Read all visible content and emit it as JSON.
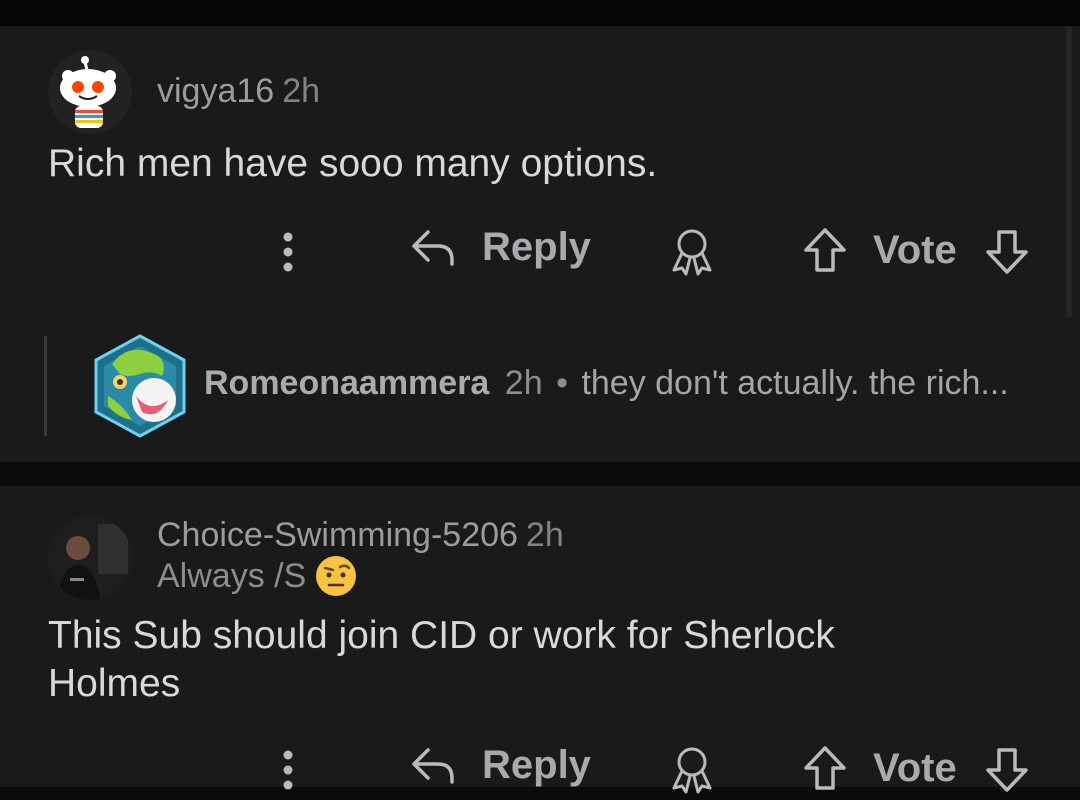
{
  "comments": [
    {
      "username": "vigya16",
      "age": "2h",
      "body": "Rich men have sooo many options.",
      "actions": {
        "reply": "Reply",
        "vote": "Vote"
      }
    },
    {
      "username": "Choice-Swimming-5206",
      "age": "2h",
      "flair": "Always /S",
      "body_line1": "This Sub should join CID or work for Sherlock",
      "body_line2": "Holmes",
      "actions": {
        "reply": "Reply",
        "vote": "Vote"
      }
    }
  ],
  "collapsed_reply": {
    "username": "Romeonaammera",
    "age": "2h",
    "separator": "•",
    "snippet": "they don't actually. the rich..."
  },
  "icons": [
    "more-options-icon",
    "reply-arrow-icon",
    "award-icon",
    "upvote-icon",
    "downvote-icon"
  ],
  "colors": {
    "background": "#1a1a1b",
    "text": "#d7dadc",
    "muted": "#9a9c9e"
  }
}
